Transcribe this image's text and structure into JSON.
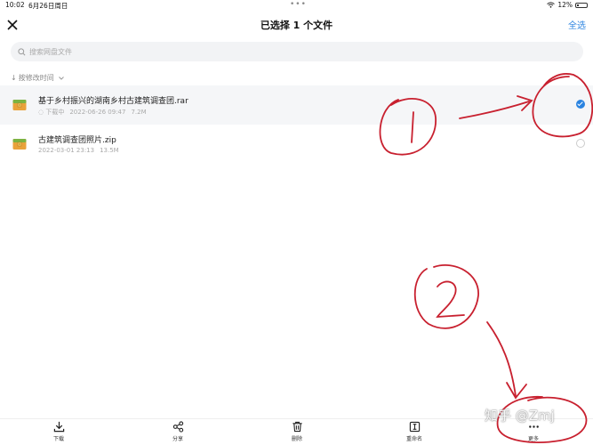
{
  "status": {
    "time": "10:02",
    "date": "6月26日周日",
    "battery": "12%"
  },
  "header": {
    "title": "已选择 1 个文件",
    "select_all": "全选"
  },
  "search": {
    "placeholder": "搜索网盘文件"
  },
  "sort": {
    "label": "按修改时间"
  },
  "files": [
    {
      "name": "基于乡村振兴的湖南乡村古建筑调查团.rar",
      "status": "下载中",
      "date": "2022-06-26 09:47",
      "size": "7.2M",
      "selected": true
    },
    {
      "name": "古建筑调查团照片.zip",
      "date": "2022-03-01 23:13",
      "size": "13.5M",
      "selected": false
    }
  ],
  "toolbar": [
    {
      "label": "下载",
      "icon": "download-icon"
    },
    {
      "label": "分享",
      "icon": "share-icon"
    },
    {
      "label": "删除",
      "icon": "trash-icon"
    },
    {
      "label": "重命名",
      "icon": "rename-icon"
    },
    {
      "label": "更多",
      "icon": "more-icon"
    }
  ],
  "watermark": "知乎 @Zmj",
  "colors": {
    "accent": "#2a83e0",
    "annotation": "#c8202f"
  }
}
